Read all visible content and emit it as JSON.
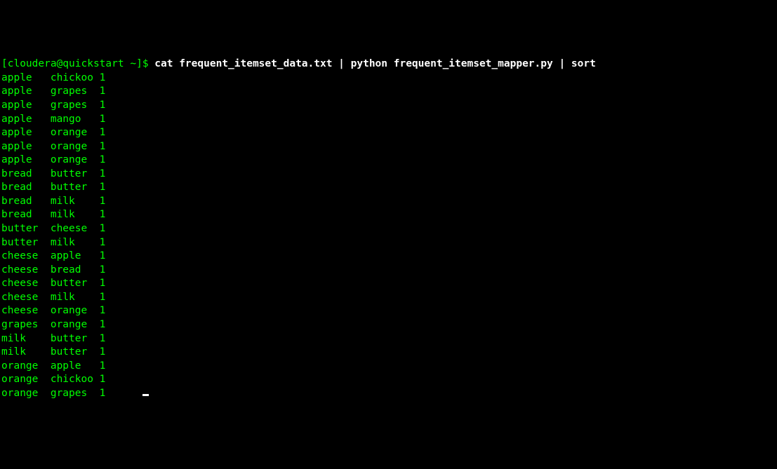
{
  "prompt": {
    "open_bracket": "[",
    "user_host": "cloudera@quickstart",
    "separator": " ",
    "cwd": "~",
    "close_bracket": "]",
    "dollar": "$ ",
    "command": "cat frequent_itemset_data.txt | python frequent_itemset_mapper.py | sort"
  },
  "output": [
    "apple   chickoo 1",
    "apple   grapes  1",
    "apple   grapes  1",
    "apple   mango   1",
    "apple   orange  1",
    "apple   orange  1",
    "apple   orange  1",
    "bread   butter  1",
    "bread   butter  1",
    "bread   milk    1",
    "bread   milk    1",
    "butter  cheese  1",
    "butter  milk    1",
    "cheese  apple   1",
    "cheese  bread   1",
    "cheese  butter  1",
    "cheese  milk    1",
    "cheese  orange  1",
    "grapes  orange  1",
    "milk    butter  1",
    "milk    butter  1",
    "orange  apple   1",
    "orange  chickoo 1",
    "orange  grapes  1"
  ]
}
